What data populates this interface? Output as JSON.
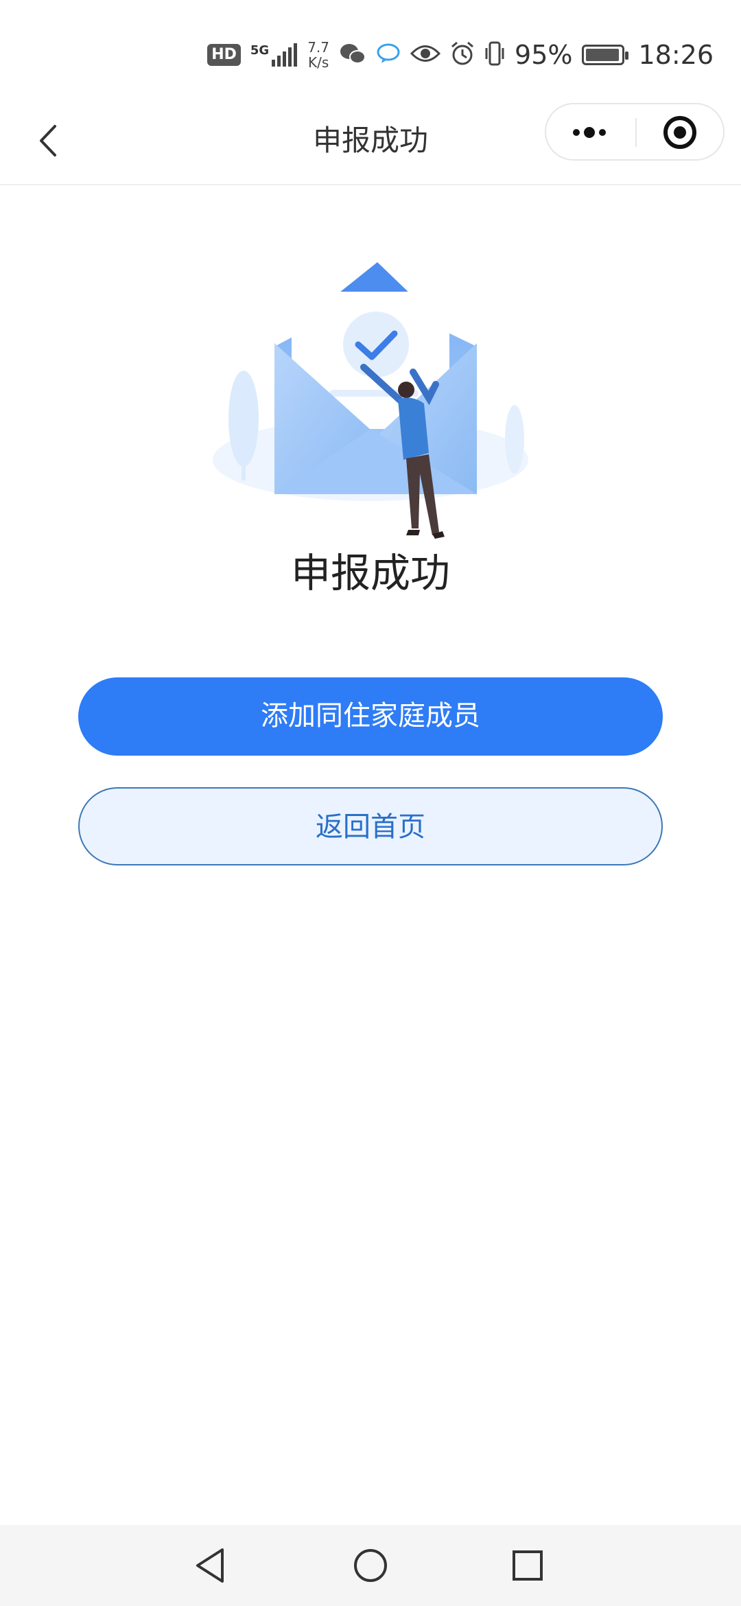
{
  "status_bar": {
    "hd": "HD",
    "network": "5G",
    "speed_value": "7.7",
    "speed_unit": "K/s",
    "battery_percent": "95%",
    "battery_level": 0.95,
    "time": "18:26",
    "icons": [
      "signal-icon",
      "wechat-icon",
      "chat-icon",
      "eye-icon",
      "alarm-icon",
      "vibrate-icon",
      "battery-icon"
    ]
  },
  "nav": {
    "title": "申报成功",
    "back_icon": "chevron-left-icon",
    "more_icon": "more-dots-icon",
    "close_icon": "target-close-icon"
  },
  "result": {
    "title": "申报成功",
    "illustration": "envelope-success-illustration"
  },
  "actions": {
    "primary_label": "添加同住家庭成员",
    "secondary_label": "返回首页"
  },
  "colors": {
    "primary": "#2e7cf6",
    "secondary_bg": "#eaf3ff",
    "secondary_text": "#2a6fc9"
  },
  "system_nav": {
    "buttons": [
      "back-triangle-icon",
      "home-circle-icon",
      "recents-square-icon"
    ]
  }
}
